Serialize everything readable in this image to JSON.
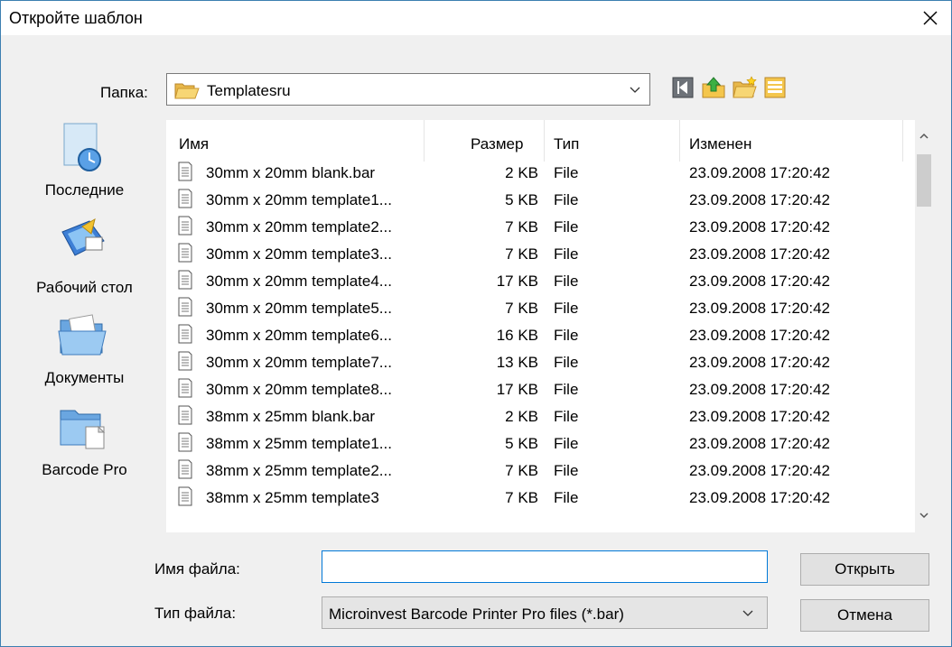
{
  "dialog": {
    "title": "Откройте шаблон"
  },
  "folder": {
    "label": "Папка:",
    "current": "Templatesru"
  },
  "places": [
    {
      "label": "Последние",
      "icon": "recent-icon"
    },
    {
      "label": "Рабочий стол",
      "icon": "desktop-icon"
    },
    {
      "label": "Документы",
      "icon": "documents-icon"
    },
    {
      "label": "Barcode Pro",
      "icon": "folder-icon"
    }
  ],
  "columns": {
    "name": "Имя",
    "size": "Размер",
    "type": "Тип",
    "modified": "Изменен"
  },
  "files": [
    {
      "name": "30mm x 20mm blank.bar",
      "size": "2 KB",
      "type": "File",
      "modified": "23.09.2008 17:20:42"
    },
    {
      "name": "30mm x 20mm template1...",
      "size": "5 KB",
      "type": "File",
      "modified": "23.09.2008 17:20:42"
    },
    {
      "name": "30mm x 20mm template2...",
      "size": "7 KB",
      "type": "File",
      "modified": "23.09.2008 17:20:42"
    },
    {
      "name": "30mm x 20mm template3...",
      "size": "7 KB",
      "type": "File",
      "modified": "23.09.2008 17:20:42"
    },
    {
      "name": "30mm x 20mm template4...",
      "size": "17 KB",
      "type": "File",
      "modified": "23.09.2008 17:20:42"
    },
    {
      "name": "30mm x 20mm template5...",
      "size": "7 KB",
      "type": "File",
      "modified": "23.09.2008 17:20:42"
    },
    {
      "name": "30mm x 20mm template6...",
      "size": "16 KB",
      "type": "File",
      "modified": "23.09.2008 17:20:42"
    },
    {
      "name": "30mm x 20mm template7...",
      "size": "13 KB",
      "type": "File",
      "modified": "23.09.2008 17:20:42"
    },
    {
      "name": "30mm x 20mm template8...",
      "size": "17 KB",
      "type": "File",
      "modified": "23.09.2008 17:20:42"
    },
    {
      "name": "38mm x 25mm blank.bar",
      "size": "2 KB",
      "type": "File",
      "modified": "23.09.2008 17:20:42"
    },
    {
      "name": "38mm x 25mm template1...",
      "size": "5 KB",
      "type": "File",
      "modified": "23.09.2008 17:20:42"
    },
    {
      "name": "38mm x 25mm template2...",
      "size": "7 KB",
      "type": "File",
      "modified": "23.09.2008 17:20:42"
    },
    {
      "name": "38mm x 25mm template3",
      "size": "7 KB",
      "type": "File",
      "modified": "23.09.2008 17:20:42"
    }
  ],
  "filename": {
    "label": "Имя файла:",
    "value": ""
  },
  "filetype": {
    "label": "Тип файла:",
    "value": "Microinvest Barcode Printer Pro files (*.bar)"
  },
  "buttons": {
    "open": "Открыть",
    "cancel": "Отмена"
  },
  "colors": {
    "accent": "#0078d7",
    "background": "#f0f0f0"
  }
}
